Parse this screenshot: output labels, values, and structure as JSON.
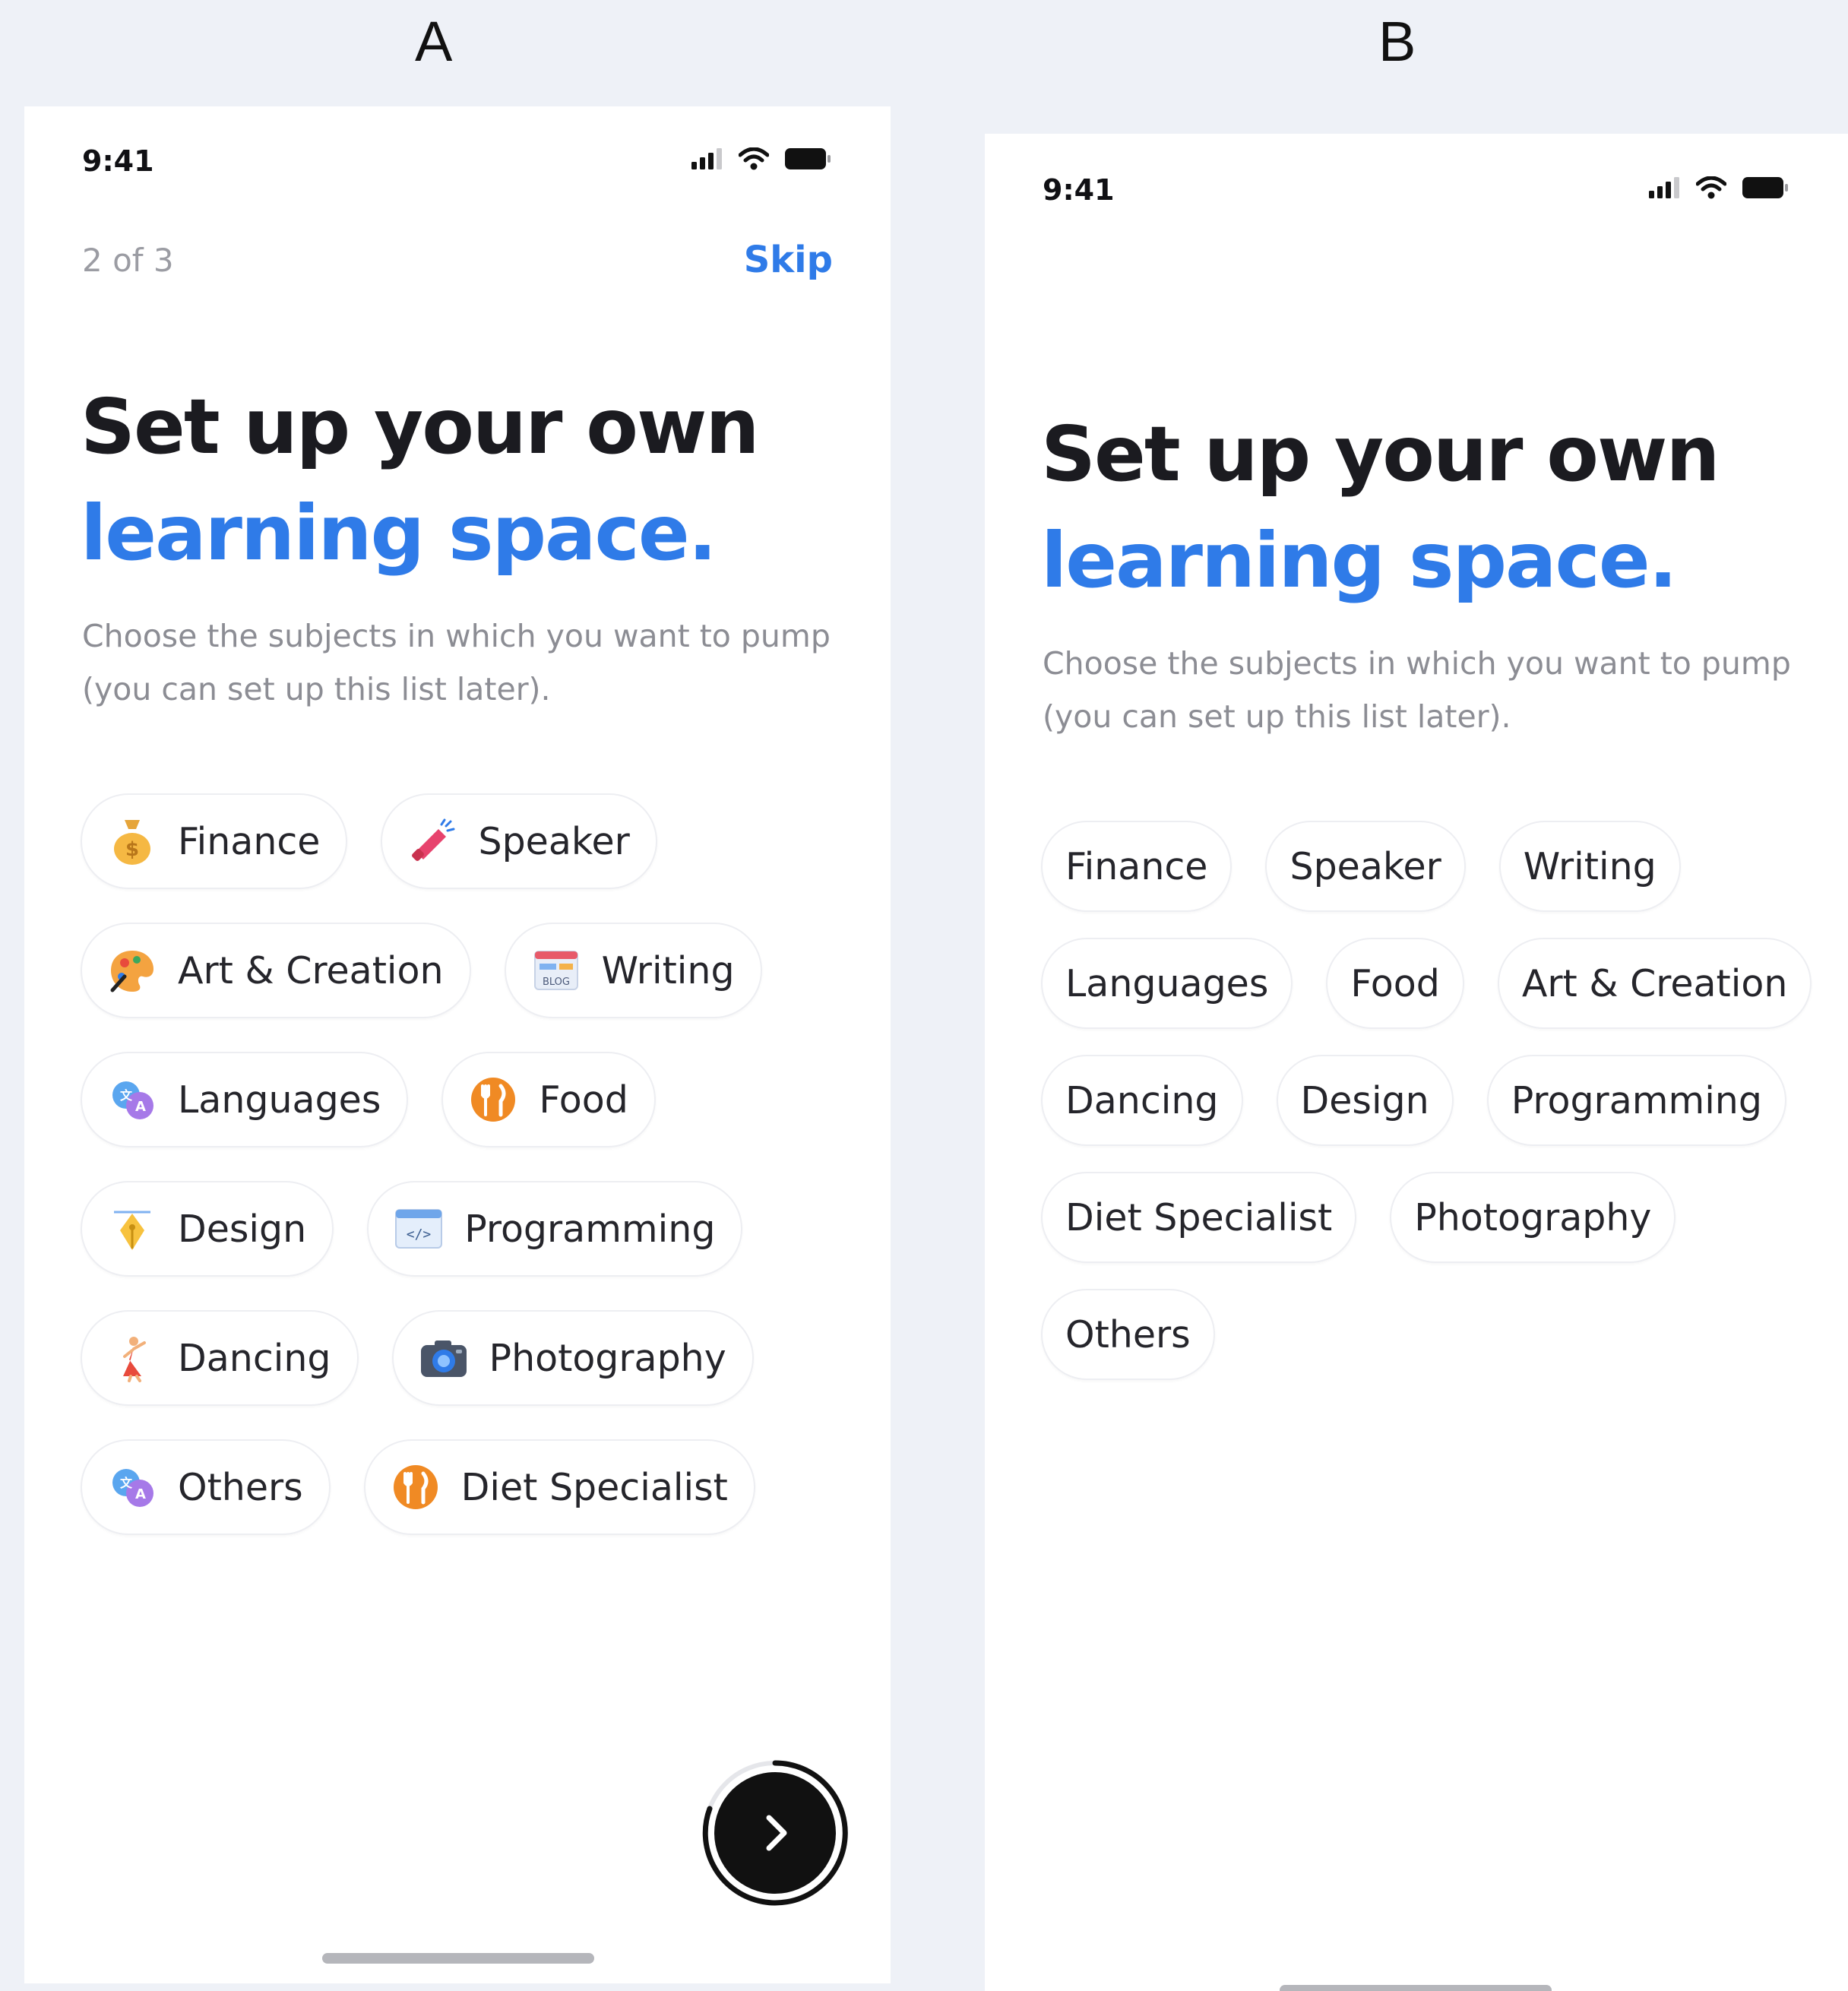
{
  "labels": {
    "a": "A",
    "b": "B"
  },
  "colors": {
    "accent": "#2f7be8",
    "heading": "#1b1b20",
    "muted": "#8c8d94",
    "background": "#eef1f7"
  },
  "screen_a": {
    "status": {
      "time": "9:41",
      "icons": [
        "signal-icon",
        "wifi-icon",
        "battery-icon"
      ]
    },
    "progress": "2 of 3",
    "skip": "Skip",
    "heading_line1": "Set up your own",
    "heading_line2": "learning space.",
    "subtitle": "Choose the subjects in which you want to pump (you can set up this list later).",
    "chips": [
      {
        "label": "Finance",
        "icon": "money-bag-icon"
      },
      {
        "label": "Speaker",
        "icon": "megaphone-icon"
      },
      {
        "label": "Art & Creation",
        "icon": "palette-icon"
      },
      {
        "label": "Writing",
        "icon": "blog-icon"
      },
      {
        "label": "Languages",
        "icon": "translate-icon"
      },
      {
        "label": "Food",
        "icon": "fork-knife-icon"
      },
      {
        "label": "Design",
        "icon": "pen-nib-icon"
      },
      {
        "label": "Programming",
        "icon": "code-window-icon"
      },
      {
        "label": "Dancing",
        "icon": "dancer-icon"
      },
      {
        "label": "Photography",
        "icon": "camera-icon"
      },
      {
        "label": "Others",
        "icon": "translate-icon"
      },
      {
        "label": "Diet Specialist",
        "icon": "fork-knife-icon"
      }
    ],
    "next_button_icon": "chevron-right-icon"
  },
  "screen_b": {
    "status": {
      "time": "9:41",
      "icons": [
        "signal-icon",
        "wifi-icon",
        "battery-icon"
      ]
    },
    "heading_line1": "Set up your own",
    "heading_line2": "learning space.",
    "subtitle": "Choose the subjects in which you want to pump (you can set up this list later).",
    "chips": [
      {
        "label": "Finance"
      },
      {
        "label": "Speaker"
      },
      {
        "label": "Writing"
      },
      {
        "label": "Languages"
      },
      {
        "label": "Food"
      },
      {
        "label": "Art & Creation"
      },
      {
        "label": "Dancing"
      },
      {
        "label": "Design"
      },
      {
        "label": "Programming"
      },
      {
        "label": "Diet Specialist"
      },
      {
        "label": "Photography"
      },
      {
        "label": "Others"
      }
    ]
  }
}
